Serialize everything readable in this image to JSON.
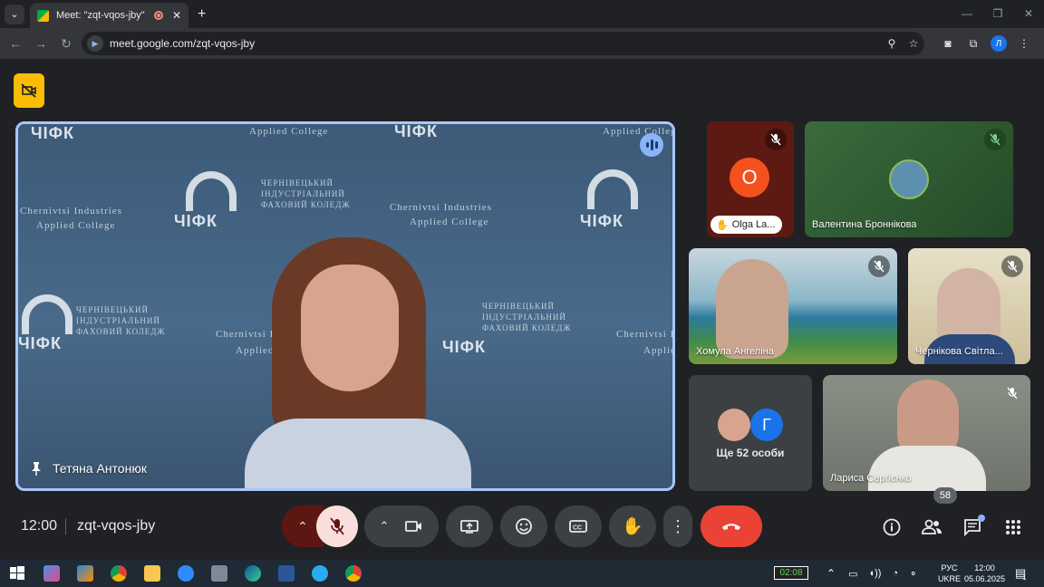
{
  "browser": {
    "tab_title": "Meet: \"zqt-vqos-jby\"",
    "url": "meet.google.com/zqt-vqos-jby",
    "profile_initial": "Л"
  },
  "main_speaker": {
    "name": "Тетяна Антонюк",
    "backdrop_lines": [
      "ЧЕРНІВЕЦЬКИЙ",
      "ІНДУСТРІАЛЬНИЙ",
      "ФАХОВИЙ КОЛЕДЖ",
      "Chernivtsi Industries",
      "Applied College",
      "ЧІФК"
    ]
  },
  "participants": [
    {
      "name": "Olga La...",
      "initial": "O",
      "hand_raised": true
    },
    {
      "name": "Валентина Броннікова"
    },
    {
      "name": "Хомула Ангеліна"
    },
    {
      "name": "Чернікова Світла..."
    },
    {
      "name": "Лариса Сергієнко"
    }
  ],
  "overflow": {
    "label": "Ще 52 особи",
    "initial": "Г"
  },
  "bottom_bar": {
    "time": "12:00",
    "meeting_code": "zqt-vqos-jby",
    "people_count": "58"
  },
  "taskbar": {
    "timer": "02:08",
    "lang_top": "РУС",
    "lang_bottom": "UKRE",
    "clock_time": "12:00",
    "clock_date": "05.06.2025",
    "notification_count": "1"
  },
  "colors": {
    "background": "#202124",
    "active_border": "#a8c7fa",
    "end_call": "#ea4335",
    "warning_button": "#fbbc04"
  }
}
